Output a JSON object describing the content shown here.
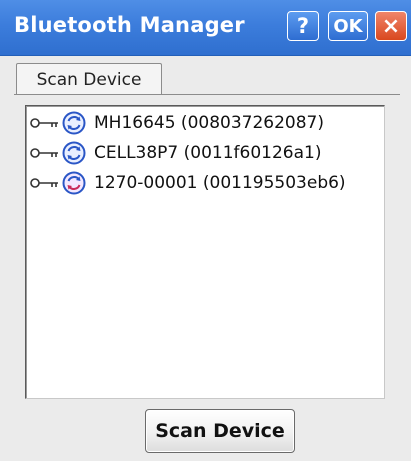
{
  "window": {
    "title": "Bluetooth Manager",
    "help_label": "?",
    "ok_label": "OK",
    "close_label": "×"
  },
  "tabs": [
    {
      "label": "Scan Device",
      "selected": true
    }
  ],
  "devices": [
    {
      "label": "MH16645 (008037262087)",
      "key_icon": "key-icon",
      "status_icon": "bluetooth-sync-icon"
    },
    {
      "label": "CELL38P7 (0011f60126a1)",
      "key_icon": "key-icon",
      "status_icon": "bluetooth-sync-icon"
    },
    {
      "label": "1270-00001 (001195503eb6)",
      "key_icon": "key-icon",
      "status_icon": "bluetooth-sync-icon"
    }
  ],
  "actions": {
    "scan_label": "Scan Device"
  },
  "colors": {
    "titlebar": "#3c7ddc",
    "close_button": "#e0552e",
    "bt_icon": "#2a56c6"
  }
}
